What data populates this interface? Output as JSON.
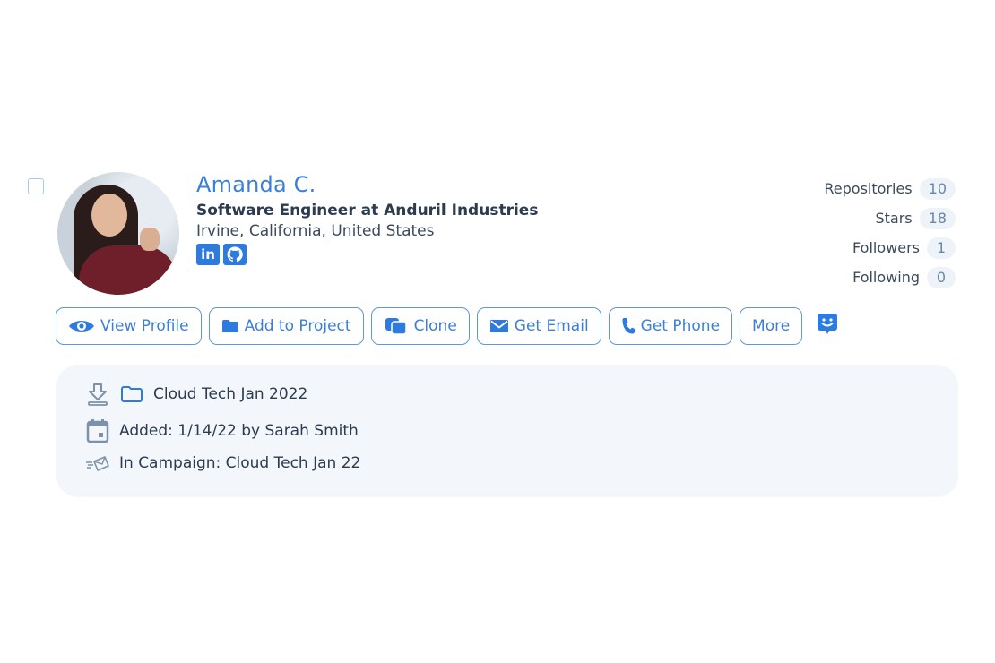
{
  "profile": {
    "name": "Amanda C.",
    "title": "Software Engineer at Anduril Industries",
    "location": "Irvine, California, United States",
    "avatar": "profile-photo",
    "socials": [
      {
        "name": "linkedin",
        "glyph": "in"
      },
      {
        "name": "github",
        "glyph": ""
      }
    ]
  },
  "stats": [
    {
      "label": "Repositories",
      "value": "10"
    },
    {
      "label": "Stars",
      "value": "18"
    },
    {
      "label": "Followers",
      "value": "1"
    },
    {
      "label": "Following",
      "value": "0"
    }
  ],
  "actions": {
    "view_profile": "View Profile",
    "add_to_project": "Add to Project",
    "clone": "Clone",
    "get_email": "Get Email",
    "get_phone": "Get Phone",
    "more": "More"
  },
  "details": {
    "project": "Cloud Tech Jan 2022",
    "added": "Added: 1/14/22 by Sarah Smith",
    "campaign": "In Campaign: Cloud Tech Jan 22"
  },
  "colors": {
    "accent": "#3a7fd9",
    "icon_blue": "#2e7be0",
    "details_bg": "#f3f6fb",
    "muted_icon": "#7d92a8"
  }
}
